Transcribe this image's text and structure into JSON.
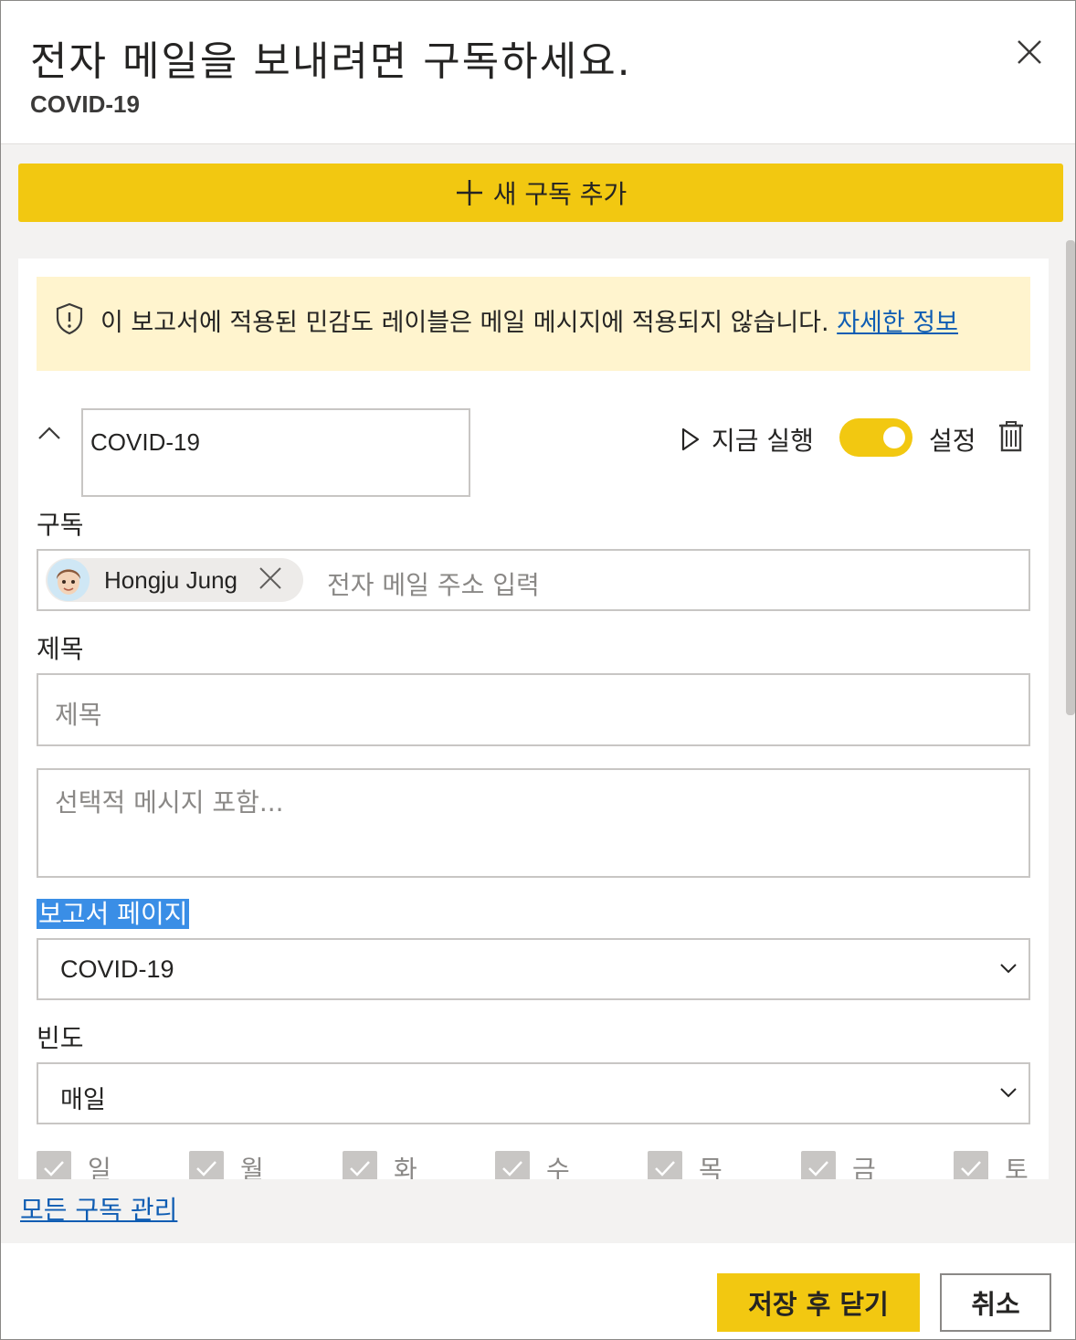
{
  "dialog": {
    "title": "전자 메일을 보내려면 구독하세요.",
    "subtitle": "COVID-19"
  },
  "toolbar": {
    "add_subscription_label": "새 구독 추가"
  },
  "notice": {
    "text": "이 보고서에 적용된 민감도 레이블은 메일 메시지에 적용되지 않습니다. ",
    "link_text": "자세한 정보"
  },
  "subscription": {
    "name_value": "COVID-19",
    "run_now_label": "지금 실행",
    "toggle_label": "설정",
    "toggle_on": true
  },
  "recipients": {
    "label": "구독",
    "chips": [
      {
        "name": "Hongju Jung"
      }
    ],
    "placeholder": "전자 메일 주소 입력"
  },
  "subject": {
    "label": "제목",
    "placeholder": "제목"
  },
  "message": {
    "placeholder": "선택적 메시지 포함..."
  },
  "report_page": {
    "label": "보고서 페이지",
    "selected": "COVID-19"
  },
  "frequency": {
    "label": "빈도",
    "selected": "매일"
  },
  "days": [
    {
      "label": "일",
      "checked": true
    },
    {
      "label": "월",
      "checked": true
    },
    {
      "label": "화",
      "checked": true
    },
    {
      "label": "수",
      "checked": true
    },
    {
      "label": "목",
      "checked": true
    },
    {
      "label": "금",
      "checked": true
    },
    {
      "label": "토",
      "checked": true
    }
  ],
  "links": {
    "manage_all": "모든 구독 관리"
  },
  "footer": {
    "save_label": "저장 후 닫기",
    "cancel_label": "취소"
  },
  "colors": {
    "accent": "#f2c811",
    "notice_bg": "#fff4ce",
    "link": "#0f5db3",
    "selection": "#3a8ee6"
  },
  "icons": [
    "close-icon",
    "plus-icon",
    "shield-icon",
    "chevron-up-icon",
    "play-icon",
    "trash-icon",
    "remove-icon",
    "chevron-down-icon",
    "checkmark-icon",
    "avatar-icon"
  ]
}
